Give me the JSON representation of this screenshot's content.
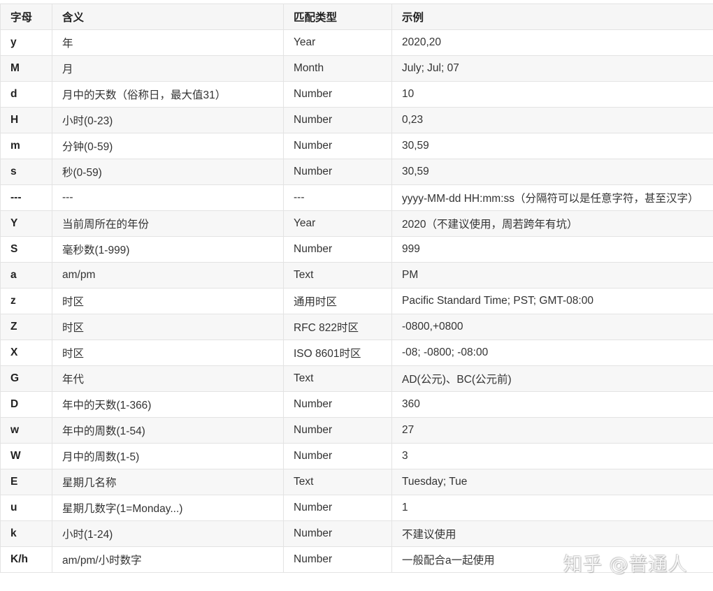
{
  "table": {
    "headers": [
      "字母",
      "含义",
      "匹配类型",
      "示例"
    ],
    "rows": [
      {
        "letter": "y",
        "meaning": "年",
        "type": "Year",
        "example": "2020,20"
      },
      {
        "letter": "M",
        "meaning": "月",
        "type": "Month",
        "example": "July; Jul; 07"
      },
      {
        "letter": "d",
        "meaning": "月中的天数（俗称日，最大值31）",
        "type": "Number",
        "example": "10"
      },
      {
        "letter": "H",
        "meaning": "小时(0-23)",
        "type": "Number",
        "example": "0,23"
      },
      {
        "letter": "m",
        "meaning": "分钟(0-59)",
        "type": "Number",
        "example": "30,59"
      },
      {
        "letter": "s",
        "meaning": "秒(0-59)",
        "type": "Number",
        "example": "30,59"
      },
      {
        "letter": "---",
        "meaning": "---",
        "type": "---",
        "example": "yyyy-MM-dd HH:mm:ss（分隔符可以是任意字符，甚至汉字）"
      },
      {
        "letter": "Y",
        "meaning": "当前周所在的年份",
        "type": "Year",
        "example": "2020（不建议使用，周若跨年有坑）"
      },
      {
        "letter": "S",
        "meaning": "毫秒数(1-999)",
        "type": "Number",
        "example": "999"
      },
      {
        "letter": "a",
        "meaning": "am/pm",
        "type": "Text",
        "example": "PM"
      },
      {
        "letter": "z",
        "meaning": "时区",
        "type": "通用时区",
        "example": "Pacific Standard Time; PST; GMT-08:00"
      },
      {
        "letter": "Z",
        "meaning": "时区",
        "type": "RFC 822时区",
        "example": "-0800,+0800"
      },
      {
        "letter": "X",
        "meaning": "时区",
        "type": "ISO 8601时区",
        "example": "-08; -0800; -08:00"
      },
      {
        "letter": "G",
        "meaning": "年代",
        "type": "Text",
        "example": "AD(公元)、BC(公元前)"
      },
      {
        "letter": "D",
        "meaning": "年中的天数(1-366)",
        "type": "Number",
        "example": "360"
      },
      {
        "letter": "w",
        "meaning": "年中的周数(1-54)",
        "type": "Number",
        "example": "27"
      },
      {
        "letter": "W",
        "meaning": "月中的周数(1-5)",
        "type": "Number",
        "example": "3"
      },
      {
        "letter": "E",
        "meaning": "星期几名称",
        "type": "Text",
        "example": "Tuesday; Tue"
      },
      {
        "letter": "u",
        "meaning": "星期几数字(1=Monday...)",
        "type": "Number",
        "example": "1"
      },
      {
        "letter": "k",
        "meaning": "小时(1-24)",
        "type": "Number",
        "example": "不建议使用"
      },
      {
        "letter": "K/h",
        "meaning": "am/pm/小时数字",
        "type": "Number",
        "example": "一般配合a一起使用"
      }
    ]
  },
  "watermark": "知乎 @普通人"
}
